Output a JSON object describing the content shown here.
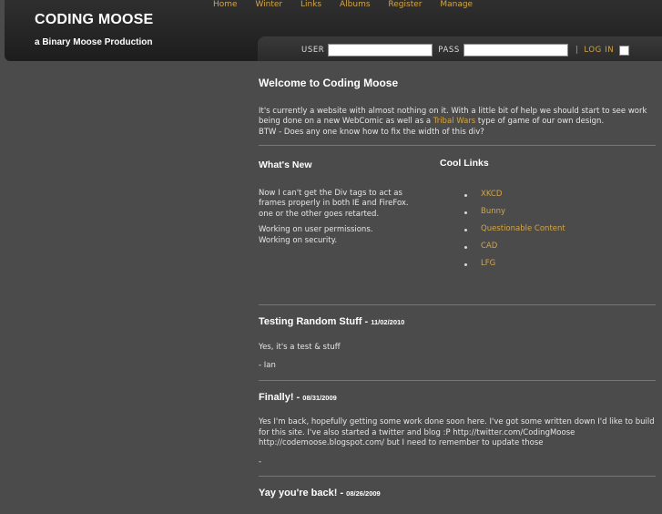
{
  "site": {
    "title": "CODING MOOSE",
    "tagline": "a Binary Moose Production"
  },
  "nav": [
    "Home",
    "Winter",
    "Links",
    "Albums",
    "Register",
    "Manage"
  ],
  "login": {
    "user_label": "USER",
    "pass_label": "PASS",
    "separator": "|",
    "login_label": "LOG IN"
  },
  "welcome": {
    "title": "Welcome to Coding Moose",
    "text_before_link": "It's currently a website with almost nothing on it. With a little bit of help we should start to see work being done on a new WebComic as well as a ",
    "link": "Tribal Wars",
    "text_after_link": " type of game of our own design.",
    "line2": "BTW - Does any one know how to fix the width of this div?"
  },
  "whats_new": {
    "title": "What's New",
    "para1": "Now I can't get the Div tags to act as frames properly in both IE and FireFox. one or the other goes retarted.",
    "para2_line1": "Working on user permissions.",
    "para2_line2": "Working on security."
  },
  "cool_links": {
    "title": "Cool Links",
    "items": [
      "XKCD",
      "Bunny",
      "Questionable Content",
      "CAD",
      "LFG"
    ]
  },
  "posts": [
    {
      "title": "Testing Random Stuff - ",
      "date": "11/02/2010",
      "body": "Yes, it's a test & stuff",
      "sign": "- Ian"
    },
    {
      "title": "Finally! - ",
      "date": "08/31/2009",
      "body": "Yes I'm back, hopefully getting some work done soon here. I've got some written down I'd like to build for this site. I've also started a twitter and blog :P http://twitter.com/CodingMoose http://codemoose.blogspot.com/ but I need to remember to update those",
      "sign": "-"
    },
    {
      "title": "Yay you're back! - ",
      "date": "08/26/2009"
    }
  ],
  "colors": {
    "background": "#4b4b4b",
    "header": "#252525",
    "accent": "#d2a54a",
    "text": "#e8e8e8"
  }
}
